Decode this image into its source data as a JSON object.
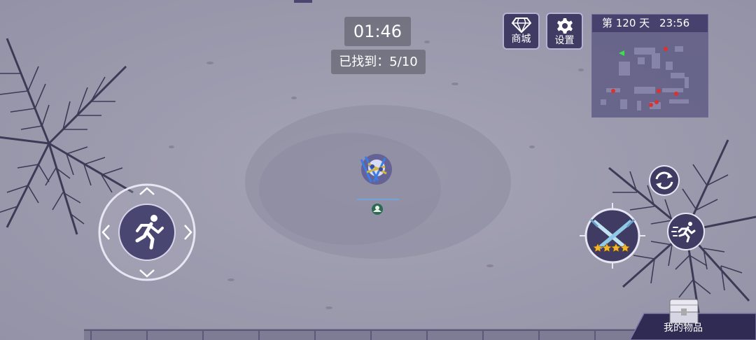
{
  "hud": {
    "timer": "01:46",
    "found_text": "已找到：5/10"
  },
  "buttons": {
    "shop_label": "商城",
    "settings_label": "设置"
  },
  "minimap": {
    "day_label": "第 120 天",
    "clock": "23:56"
  },
  "weapon": {
    "stars": 4
  },
  "inventory": {
    "label": "我的物品"
  },
  "icons": {
    "shop": "diamond-icon",
    "settings": "gear-icon",
    "joystick": "running-man-icon",
    "swap": "refresh-icon",
    "weapon": "crossed-swords-icon",
    "sprint": "sprint-icon",
    "inventory": "chest-icon"
  },
  "colors": {
    "hud_button_bg": "#3f3b63",
    "minimap_header": "#46426d",
    "star": "#f2b62a",
    "enemy_dot": "#e0302a",
    "player_marker": "#3ee04a"
  }
}
